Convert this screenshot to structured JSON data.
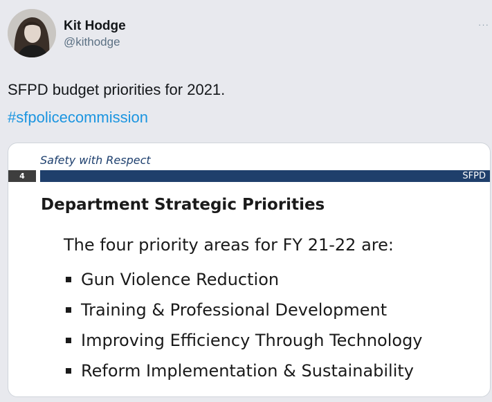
{
  "user": {
    "display_name": "Kit Hodge",
    "handle": "@kithodge"
  },
  "more_icon": "more-horizontal-icon",
  "tweet": {
    "text": "SFPD budget priorities for 2021.",
    "hashtag": "#sfpolicecommission"
  },
  "slide": {
    "tagline": "Safety with Respect",
    "page_number": "4",
    "brand": "SFPD",
    "title": "Department Strategic Priorities",
    "intro": "The four priority areas for FY 21-22 are:",
    "items": [
      "Gun Violence Reduction",
      "Training & Professional Development",
      "Improving Efficiency Through Technology",
      "Reform Implementation & Sustainability"
    ]
  },
  "colors": {
    "hashtag": "#1b95e0",
    "slide_bar": "#1f3f6b",
    "tagline": "#1d3f6e"
  }
}
